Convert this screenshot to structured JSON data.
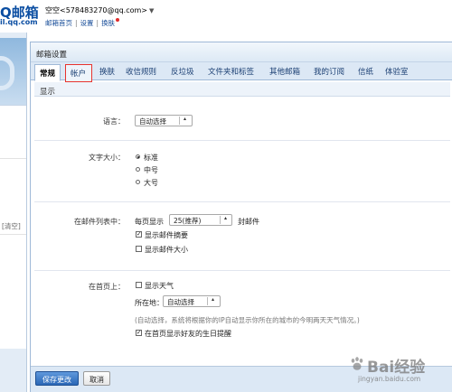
{
  "header": {
    "logo_main": "Q邮箱",
    "logo_sub": "il.qq.com",
    "user_name": "空空",
    "user_email": "<578483270@qq.com>",
    "user_dropdown_glyph": "▼",
    "links": [
      "邮箱首页",
      "设置",
      "换肤"
    ],
    "link_separator": "|",
    "badge_color": "#e02a2a"
  },
  "left_strip": {
    "clear_text": "[清空]"
  },
  "panel": {
    "title": "邮箱设置",
    "tabs": [
      {
        "label": "常规",
        "state": "active"
      },
      {
        "label": "帐户",
        "state": "highlighted"
      },
      {
        "label": "换肤",
        "state": "normal"
      },
      {
        "label": "收信规则",
        "state": "normal"
      },
      {
        "label": "反垃圾",
        "state": "normal"
      },
      {
        "label": "文件夹和标签",
        "state": "normal"
      },
      {
        "label": "其他邮箱",
        "state": "normal"
      },
      {
        "label": "我的订阅",
        "state": "normal"
      },
      {
        "label": "信纸",
        "state": "normal"
      },
      {
        "label": "体验室",
        "state": "normal"
      }
    ],
    "section": "显示",
    "language": {
      "label": "语言：",
      "value": "自动选择"
    },
    "font_size": {
      "label": "文字大小：",
      "options": [
        {
          "label": "标准",
          "checked": true
        },
        {
          "label": "中号",
          "checked": false
        },
        {
          "label": "大号",
          "checked": false
        }
      ]
    },
    "mail_list": {
      "label": "在邮件列表中：",
      "prefix": "每页显示",
      "value": "25(推荐)",
      "suffix": "封邮件",
      "checkboxes": [
        {
          "label": "显示邮件摘要",
          "checked": true
        },
        {
          "label": "显示邮件大小",
          "checked": false
        }
      ]
    },
    "home_page": {
      "label": "在首页上：",
      "weather_checkbox": {
        "label": "显示天气",
        "checked": false
      },
      "location_label": "所在地：",
      "location_value": "自动选择",
      "note": "(自动选择，系统将根据你的IP自动显示你所在的城市的今明两天天气情况。)",
      "birthday_checkbox": {
        "label": "在首页显示好友的生日提醒",
        "checked": true
      }
    },
    "buttons": {
      "save": "保存更改",
      "cancel": "取消"
    }
  },
  "watermark": {
    "text": "Bai经验",
    "url": "jingyan.baidu.com"
  },
  "colors": {
    "accent_blue": "#2a67b6",
    "highlight_red": "#e8342f",
    "tab_bar": "#dce8f5"
  }
}
